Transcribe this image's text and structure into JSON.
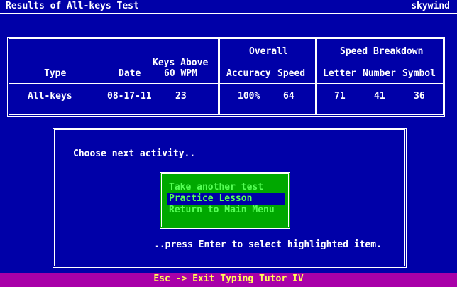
{
  "window": {
    "title": "Results of All-keys Test",
    "user": "skywind"
  },
  "results": {
    "headers": {
      "type": "Type",
      "date": "Date",
      "keys_above_line1": "Keys Above",
      "keys_above_line2": "60 WPM",
      "overall": "Overall",
      "accuracy": "Accuracy",
      "speed": "Speed",
      "speed_breakdown": "Speed Breakdown",
      "letter": "Letter",
      "number": "Number",
      "symbol": "Symbol"
    },
    "row": {
      "type": "All-keys",
      "date": "08-17-11",
      "keys_above": "23",
      "accuracy": "100%",
      "speed": "64",
      "letter": "71",
      "number": "41",
      "symbol": "36"
    }
  },
  "dialog": {
    "prompt": "Choose next activity..",
    "menu": [
      {
        "label": "Take another test",
        "selected": false
      },
      {
        "label": "Practice Lesson",
        "selected": true
      },
      {
        "label": "Return to Main Menu",
        "selected": false
      }
    ],
    "hint": "..press Enter to select highlighted item."
  },
  "statusbar": {
    "text": "Esc -> Exit Typing Tutor IV"
  },
  "colors": {
    "background": "#0000a8",
    "text": "#ffffff",
    "menu_bg": "#00a800",
    "menu_text": "#55ff55",
    "status_bg": "#a800a8",
    "status_text": "#ffff55"
  }
}
